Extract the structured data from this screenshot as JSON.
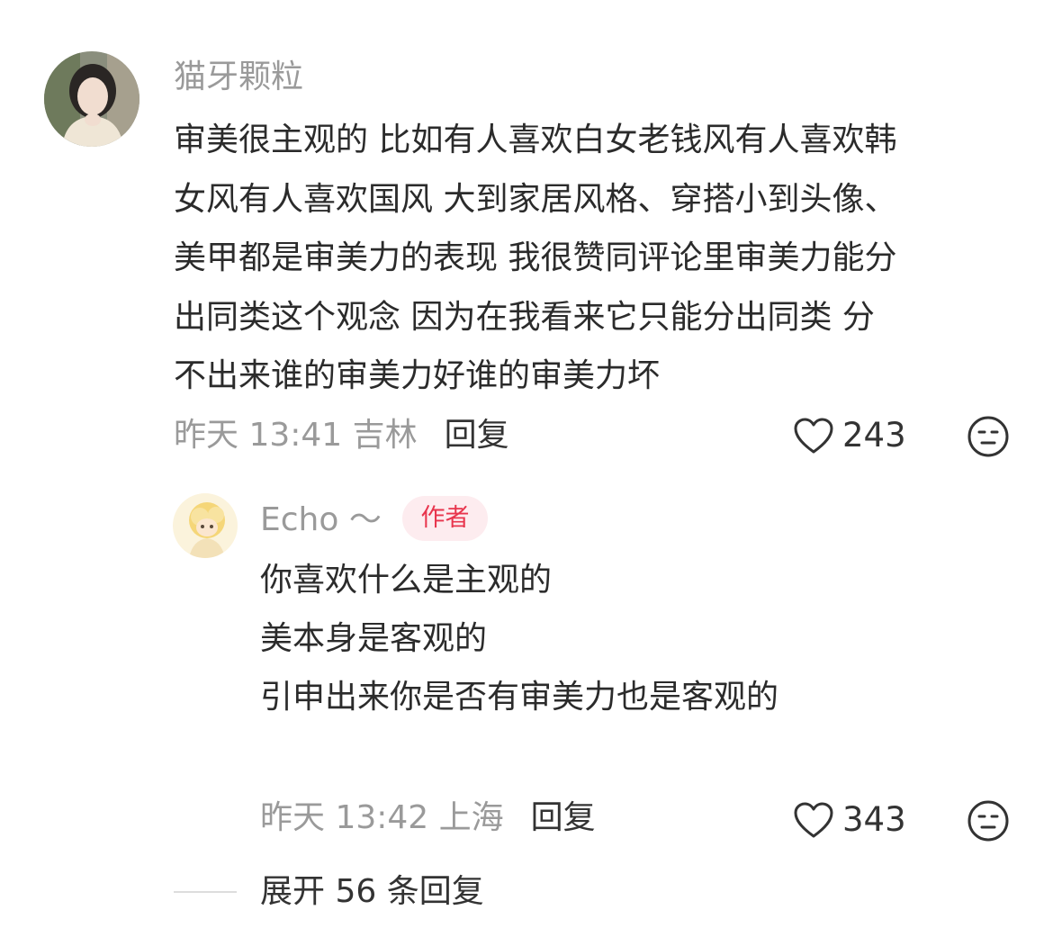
{
  "main_comment": {
    "username": "猫牙颗粒",
    "lines": [
      "审美很主观的 比如有人喜欢白女老钱风有人喜欢韩",
      "女风有人喜欢国风 大到家居风格、穿搭小到头像、",
      "美甲都是审美力的表现 我很赞同评论里审美力能分",
      "出同类这个观念 因为在我看来它只能分出同类 分",
      "不出来谁的审美力好谁的审美力坏"
    ],
    "meta": "昨天 13:41 吉林",
    "reply_label": "回复",
    "likes": "243"
  },
  "reply_comment": {
    "username": "Echo ～",
    "badge": "作者",
    "lines": [
      "你喜欢什么是主观的",
      "美本身是客观的",
      "引申出来你是否有审美力也是客观的"
    ],
    "meta": "昨天 13:42 上海",
    "reply_label": "回复",
    "likes": "343"
  },
  "expand": {
    "label": "展开 56 条回复"
  },
  "colors": {
    "secondary_text": "#9a9a9a",
    "primary_text": "#2b2b2b",
    "badge_bg": "#fdecef",
    "badge_text": "#e8354d"
  }
}
